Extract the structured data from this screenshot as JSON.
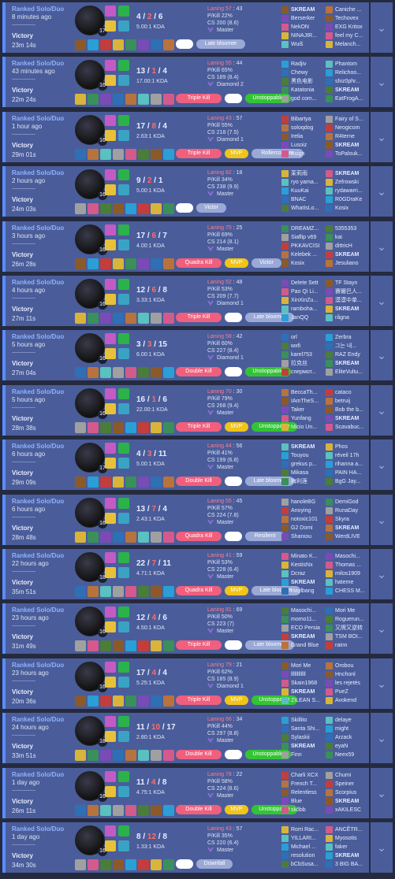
{
  "queue_label": "Ranked Solo/Duo",
  "more_icon": "chevron-down-icon",
  "colors": {
    "card_bg": "#4a5d9a",
    "win_border": "#5b8cff",
    "deaths": "#ff6b6b",
    "badge_multikill": "#f05f7d",
    "badge_mvp": "#f0c419",
    "badge_unstoppable": "#33c433",
    "badge_generic": "#9aa9d6"
  },
  "matches": [
    {
      "ago": "8 minutes ago",
      "result": "Victory",
      "duration": "23m 14s",
      "level": "17",
      "k": "4",
      "d": "2",
      "a": "6",
      "kda": "5.00:1 KDA",
      "laning": "Laning 57",
      "laning_score": "43",
      "pkill": "P/Kill 22%",
      "cs": "CS 200 (8.6)",
      "rank": "Master",
      "badges": [
        {
          "text": "",
          "type": "white"
        },
        {
          "text": "Late bloomer",
          "type": "generic"
        }
      ],
      "team1": [
        "SKREAM",
        "Berserker",
        "NekON",
        "NINAJIR...",
        "Wuiš"
      ],
      "team2": [
        "Caniche ...",
        "Techovex",
        "EXG Kritox",
        "feel my C...",
        "Melanch..."
      ]
    },
    {
      "ago": "43 minutes ago",
      "result": "Victory",
      "duration": "22m 24s",
      "level": "16",
      "k": "13",
      "d": "1",
      "a": "4",
      "kda": "17.00:1 KDA",
      "laning": "Laning 55",
      "laning_score": "44",
      "pkill": "P/Kill 65%",
      "cs": "CS 189 (8.4)",
      "rank": "Diamond 2",
      "badges": [
        {
          "text": "Triple Kill",
          "type": "multikill"
        },
        {
          "text": "",
          "type": "white"
        },
        {
          "text": "Unstoppable",
          "type": "unstoppable"
        }
      ],
      "team1": [
        "Radjiv",
        "Chewy",
        "黑色电影",
        "Katatonia",
        "god com..."
      ],
      "team2": [
        "Phantom",
        "Relichoo...",
        "shiz0phr...",
        "SKREAM",
        "EatFrogA..."
      ]
    },
    {
      "ago": "1 hour ago",
      "result": "Victory",
      "duration": "29m 01s",
      "level": "16",
      "k": "17",
      "d": "8",
      "a": "4",
      "kda": "2.63:1 KDA",
      "laning": "Laning 43",
      "laning_score": "57",
      "pkill": "P/Kill 55%",
      "cs": "CS 218 (7.5)",
      "rank": "Diamond 1",
      "badges": [
        {
          "text": "Triple Kill",
          "type": "multikill"
        },
        {
          "text": "MVP",
          "type": "mvp"
        },
        {
          "text": "Rollercoaster",
          "type": "generic"
        }
      ],
      "team1": [
        "Bibartya",
        "soloqdog",
        "Irelia",
        "Lusoiz",
        "Asign"
      ],
      "team2": [
        "Fairy of S...",
        "Neogicom",
        "R4terne",
        "SKREAM",
        "ToPalouk..."
      ]
    },
    {
      "ago": "2 hours ago",
      "result": "Victory",
      "duration": "24m 03s",
      "level": "16",
      "k": "9",
      "d": "2",
      "a": "1",
      "kda": "5.00:1 KDA",
      "laning": "Laning 82",
      "laning_score": "18",
      "pkill": "P/Kill 34%",
      "cs": "CS 238 (9.9)",
      "rank": "Master",
      "badges": [
        {
          "text": "",
          "type": "white"
        },
        {
          "text": "Victor",
          "type": "generic"
        }
      ],
      "team1": [
        "茉莉雨",
        "ryo yama...",
        "KuuKai",
        "BNAC",
        "WhatIsLo..."
      ],
      "team2": [
        "SKREAM",
        "Zefrowski",
        "rydawarri...",
        "R0GDraKe",
        "Kosix"
      ]
    },
    {
      "ago": "3 hours ago",
      "result": "Victory",
      "duration": "26m 28s",
      "level": "16",
      "k": "17",
      "d": "6",
      "a": "7",
      "kda": "4.00:1 KDA",
      "laning": "Laning 75",
      "laning_score": "25",
      "pkill": "P/Kill 69%",
      "cs": "CS 214 (8.1)",
      "rank": "Master",
      "badges": [
        {
          "text": "Quadra Kill",
          "type": "multikill"
        },
        {
          "text": "MVP",
          "type": "mvp"
        },
        {
          "text": "Victor",
          "type": "generic"
        }
      ],
      "team1": [
        "DREAMZ...",
        "Siaflip v69",
        "PKKAVCISI",
        "Kelebek ...",
        "Kosix"
      ],
      "team2": [
        "5355353",
        "kai",
        "dittricH",
        "SKREAM",
        "Jesuliano"
      ]
    },
    {
      "ago": "4 hours ago",
      "result": "Victory",
      "duration": "27m 11s",
      "level": "16",
      "k": "12",
      "d": "6",
      "a": "8",
      "kda": "3.33:1 KDA",
      "laning": "Laning 52",
      "laning_score": "48",
      "pkill": "P/Kill 53%",
      "cs": "CS 209 (7.7)",
      "rank": "Diamond 1",
      "badges": [
        {
          "text": "Triple Kill",
          "type": "multikill"
        },
        {
          "text": "",
          "type": "white"
        },
        {
          "text": "Late bloomer",
          "type": "generic"
        }
      ],
      "team1": [
        "Delete Sett",
        "Pao Qi Li...",
        "XinXinZu...",
        "ramboha...",
        "JanQQ"
      ],
      "team2": [
        "TF Stayn",
        "賽爾巴人...",
        "漠漠中单...",
        "SKREAM",
        "rågna"
      ]
    },
    {
      "ago": "5 hours ago",
      "result": "Victory",
      "duration": "27m 04s",
      "level": "16",
      "k": "3",
      "d": "3",
      "a": "15",
      "kda": "6.00:1 KDA",
      "laning": "Laning 58",
      "laning_score": "42",
      "pkill": "P/Kill 60%",
      "cs": "CS 227 (8.4)",
      "rank": "Diamond 1",
      "badges": [
        {
          "text": "Double Kill",
          "type": "multikill"
        },
        {
          "text": "",
          "type": "white"
        },
        {
          "text": "Unstoppable",
          "type": "unstoppable"
        }
      ],
      "team1": [
        "orl",
        "wxfi",
        "karel753",
        "拉克丝",
        "спермот..."
      ],
      "team2": [
        "Zerbra",
        "그는 내...",
        "RAZ Endy",
        "SKREAM",
        "EliteVultu..."
      ]
    },
    {
      "ago": "5 hours ago",
      "result": "Victory",
      "duration": "28m 38s",
      "level": "16",
      "k": "16",
      "d": "1",
      "a": "6",
      "kda": "22.00:1 KDA",
      "laning": "Laning 70",
      "laning_score": "30",
      "pkill": "P/Kill 79%",
      "cs": "CS 268 (9.4)",
      "rank": "Master",
      "badges": [
        {
          "text": "Triple Kill",
          "type": "multikill"
        },
        {
          "text": "MVP",
          "type": "mvp"
        },
        {
          "text": "Unstoppable",
          "type": "unstoppable"
        }
      ],
      "team1": [
        "BeccaTh...",
        "IAmTheS...",
        "Taker",
        "Yunfang",
        "Micio Un..."
      ],
      "team2": [
        "cataco",
        "betruij",
        "Bob the b...",
        "SKREAM",
        "Scavabuc..."
      ]
    },
    {
      "ago": "6 hours ago",
      "result": "Victory",
      "duration": "29m 09s",
      "level": "17",
      "k": "4",
      "d": "3",
      "a": "11",
      "kda": "5.00:1 KDA",
      "laning": "Laning 44",
      "laning_score": "56",
      "pkill": "P/Kill 41%",
      "cs": "CS 199 (6.8)",
      "rank": "Master",
      "badges": [
        {
          "text": "Double Kill",
          "type": "multikill"
        },
        {
          "text": "",
          "type": "white"
        },
        {
          "text": "Late bloomer",
          "type": "generic"
        }
      ],
      "team1": [
        "SKREAM",
        "Touyou",
        "grekus p...",
        "Mikasa",
        "梅利莲"
      ],
      "team2": [
        "Phos",
        "réveil 17h",
        "rihanna a...",
        "PAIN HA...",
        "BgG Jay..."
      ]
    },
    {
      "ago": "6 hours ago",
      "result": "Victory",
      "duration": "28m 48s",
      "level": "16",
      "k": "13",
      "d": "7",
      "a": "4",
      "kda": "2.43:1 KDA",
      "laning": "Laning 55",
      "laning_score": "45",
      "pkill": "P/Kill 57%",
      "cs": "CS 224 (7.8)",
      "rank": "Master",
      "badges": [
        {
          "text": "Quadra Kill",
          "type": "multikill"
        },
        {
          "text": "",
          "type": "white"
        },
        {
          "text": "Resilient",
          "type": "generic"
        }
      ],
      "team1": [
        "hanoleBG",
        "Anoying",
        "notoxic101",
        "G2 Domi",
        "Sharxou"
      ],
      "team2": [
        "DemiGod",
        "RunaDay",
        "Skyra",
        "SKREAM",
        "WerdLIVE"
      ]
    },
    {
      "ago": "22 hours ago",
      "result": "Victory",
      "duration": "35m 51s",
      "level": "18",
      "k": "22",
      "d": "7",
      "a": "11",
      "kda": "4.71:1 KDA",
      "laning": "Laning 41",
      "laning_score": "59",
      "pkill": "P/Kill 53%",
      "cs": "CS 228 (6.4)",
      "rank": "Master",
      "badges": [
        {
          "text": "Quadra Kill",
          "type": "multikill"
        },
        {
          "text": "MVP",
          "type": "mvp"
        },
        {
          "text": "Late bloomer",
          "type": "generic"
        }
      ],
      "team1": [
        "Minato K...",
        "KestisNx",
        "Dcraz",
        "SKREAM",
        "Haylbang"
      ],
      "team2": [
        "Masochi...",
        "Thomas ...",
        "milos1909",
        "hateme",
        "CHESS M..."
      ]
    },
    {
      "ago": "23 hours ago",
      "result": "Victory",
      "duration": "31m 49s",
      "level": "16",
      "k": "12",
      "d": "4",
      "a": "6",
      "kda": "4.50:1 KDA",
      "laning": "Laning 81",
      "laning_score": "69",
      "pkill": "P/Kill 50%",
      "cs": "CS 223 (7)",
      "rank": "Master",
      "badges": [
        {
          "text": "Triple Kill",
          "type": "multikill"
        },
        {
          "text": "",
          "type": "white"
        },
        {
          "text": "Late bloomer",
          "type": "generic"
        }
      ],
      "team1": [
        "Masochi...",
        "momo11...",
        "ECO Persia",
        "SKREAM",
        "Grand Blue"
      ],
      "team2": [
        "Mori Me",
        "Roguerun...",
        "又牌又逆转",
        "TSM BOI...",
        "rainn"
      ]
    },
    {
      "ago": "23 hours ago",
      "result": "Victory",
      "duration": "20m 36s",
      "level": "16",
      "k": "17",
      "d": "4",
      "a": "4",
      "kda": "5.25:1 KDA",
      "laning": "Laning 79",
      "laning_score": "21",
      "pkill": "P/Kill 62%",
      "cs": "CS 185 (8.9)",
      "rank": "Diamond 1",
      "badges": [
        {
          "text": "Triple Kill",
          "type": "multikill"
        },
        {
          "text": "MVP",
          "type": "mvp"
        },
        {
          "text": "Unstoppable",
          "type": "unstoppable"
        }
      ],
      "team1": [
        "Mori Me",
        "llllllllllll",
        "Skain1968",
        "SKREAM",
        "ZILEAN S..."
      ],
      "team2": [
        "Orobou",
        "Hnchonl",
        "les rejetés",
        "PueZ",
        "Avokend"
      ]
    },
    {
      "ago": "24 hours ago",
      "result": "Victory",
      "duration": "33m 51s",
      "level": "18",
      "k": "11",
      "d": "10",
      "a": "17",
      "kda": "2.80:1 KDA",
      "laning": "Laning 66",
      "laning_score": "34",
      "pkill": "P/Kill 44%",
      "cs": "CS 297 (8.8)",
      "rank": "Master",
      "badges": [
        {
          "text": "Double Kill",
          "type": "multikill"
        },
        {
          "text": "",
          "type": "white"
        },
        {
          "text": "Unstoppable",
          "type": "unstoppable"
        }
      ],
      "team1": [
        "Skillito",
        "Santa Shi...",
        "Sylaskii",
        "SKREAM",
        "Finn"
      ],
      "team2": [
        "delaye",
        "might",
        "Arzack",
        "eyaN",
        "Neex59"
      ]
    },
    {
      "ago": "1 day ago",
      "result": "Victory",
      "duration": "26m 11s",
      "level": "16",
      "k": "11",
      "d": "4",
      "a": "8",
      "kda": "4.75:1 KDA",
      "laning": "Laning 78",
      "laning_score": "22",
      "pkill": "P/Kill 58%",
      "cs": "CS 224 (8.6)",
      "rank": "Master",
      "badges": [
        {
          "text": "Double Kill",
          "type": "multikill"
        },
        {
          "text": "MVP",
          "type": "mvp"
        },
        {
          "text": "Unstoppable",
          "type": "unstoppable"
        }
      ],
      "team1": [
        "Charli XCX",
        "French T...",
        "Relentless",
        "Blue",
        "skõbb"
      ],
      "team2": [
        "Chumi",
        "Speiner",
        "Scorpius",
        "SKREAM",
        "xAKILESC"
      ]
    },
    {
      "ago": "1 day ago",
      "result": "Victory",
      "duration": "34m 30s",
      "level": "16",
      "k": "8",
      "d": "12",
      "a": "8",
      "kda": "1.33:1 KDA",
      "laning": "Laning 43",
      "laning_score": "57",
      "pkill": "P/Kill 35%",
      "cs": "CS 220 (6.4)",
      "rank": "Master",
      "badges": [
        {
          "text": "",
          "type": "white"
        },
        {
          "text": "Downfall",
          "type": "generic"
        }
      ],
      "team1": [
        "Rorri Rac...",
        "YILLARI...",
        "Michael ...",
        "resolution",
        "bCbSusa..."
      ],
      "team2": [
        "ANCĚTR...",
        "Myosotis",
        "faker",
        "SKREAM",
        "3 BIG BA..."
      ]
    }
  ]
}
